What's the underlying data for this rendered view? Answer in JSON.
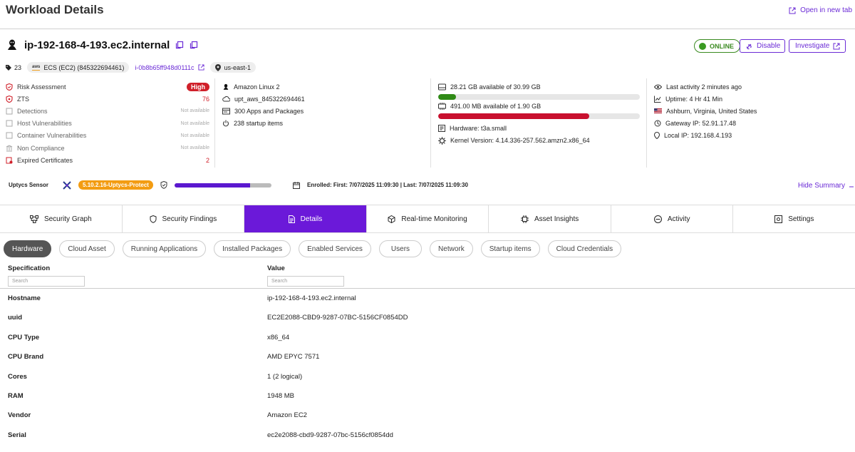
{
  "header": {
    "title": "Workload Details",
    "open_new_tab": "Open in new tab"
  },
  "host": {
    "hostname": "ip-192-168-4-193.ec2.internal",
    "status": "ONLINE",
    "disable_label": "Disable",
    "investigate_label": "Investigate"
  },
  "tags": {
    "count": "23",
    "aws_logo": "aws",
    "platform": "ECS (EC2) (845322694461)",
    "instance_id": "i-0b8b65ff948d0111c",
    "region": "us-east-1"
  },
  "risk": {
    "items": [
      {
        "label": "Risk Assessment",
        "value": "High"
      },
      {
        "label": "ZTS",
        "value": "76"
      },
      {
        "label": "Detections",
        "value": "Not available"
      },
      {
        "label": "Host Vulnerabilities",
        "value": "Not available"
      },
      {
        "label": "Container Vulnerabilities",
        "value": "Not available"
      },
      {
        "label": "Non Compliance",
        "value": "Not available"
      },
      {
        "label": "Expired Certificates",
        "value": "2"
      }
    ]
  },
  "system": {
    "os": "Amazon Linux 2",
    "account": "upt_aws_845322694461",
    "apps": "300 Apps and Packages",
    "startup": "238 startup items"
  },
  "resources": {
    "disk_text": "28.21 GB available of 30.99 GB",
    "disk_used_fraction": 0.09,
    "mem_text": "491.00 MB available of 1.90 GB",
    "mem_used_fraction": 0.75,
    "hardware": "Hardware: t3a.small",
    "kernel": "Kernel Version: 4.14.336-257.562.amzn2.x86_64"
  },
  "activity": {
    "last_activity": "Last activity 2 minutes ago",
    "uptime": "Uptime: 4 Hr 41 Min",
    "location": "Ashburn, Virginia, United States",
    "gateway": "Gateway IP: 52.91.17.48",
    "local_ip": "Local IP: 192.168.4.193"
  },
  "sensor": {
    "label": "Uptycs Sensor",
    "version": "5.10.2.16-Uptycs-Protect",
    "progress_fraction": 0.78,
    "enrolled": "Enrolled: First: 7/07/2025 11:09:30 | Last: 7/07/2025 11:09:30",
    "hide_summary": "Hide Summary"
  },
  "tabs": [
    {
      "label": "Security Graph"
    },
    {
      "label": "Security Findings"
    },
    {
      "label": "Details"
    },
    {
      "label": "Real-time Monitoring"
    },
    {
      "label": "Asset Insights"
    },
    {
      "label": "Activity"
    },
    {
      "label": "Settings"
    }
  ],
  "active_tab": "Details",
  "subtabs": [
    {
      "label": "Hardware"
    },
    {
      "label": "Cloud Asset"
    },
    {
      "label": "Running Applications"
    },
    {
      "label": "Installed Packages"
    },
    {
      "label": "Enabled Services"
    },
    {
      "label": "Users"
    },
    {
      "label": "Network"
    },
    {
      "label": "Startup items"
    },
    {
      "label": "Cloud Credentials"
    }
  ],
  "table": {
    "col_spec": "Specification",
    "col_value": "Value",
    "search_placeholder": "Search",
    "rows": [
      {
        "key": "Hostname",
        "value": "ip-192-168-4-193.ec2.internal"
      },
      {
        "key": "uuid",
        "value": "EC2E2088-CBD9-9287-07BC-5156CF0854DD"
      },
      {
        "key": "CPU Type",
        "value": "x86_64"
      },
      {
        "key": "CPU Brand",
        "value": "AMD EPYC 7571"
      },
      {
        "key": "Cores",
        "value": "1 (2 logical)"
      },
      {
        "key": "RAM",
        "value": "1948 MB"
      },
      {
        "key": "Vendor",
        "value": "Amazon EC2"
      },
      {
        "key": "Serial",
        "value": "ec2e2088-cbd9-9287-07bc-5156cf0854dd"
      }
    ]
  },
  "colors": {
    "accent": "#6B19D9",
    "danger": "#D0202A",
    "online": "#3A9A22",
    "sensor_badge": "#F39C12"
  }
}
